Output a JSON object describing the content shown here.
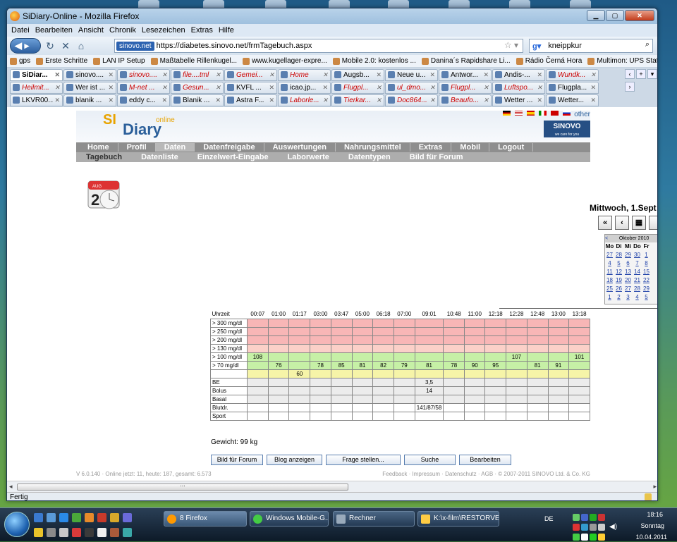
{
  "browser": {
    "window_title": "SiDiary-Online - Mozilla Firefox",
    "menu": [
      "Datei",
      "Bearbeiten",
      "Ansicht",
      "Chronik",
      "Lesezeichen",
      "Extras",
      "Hilfe"
    ],
    "identity_badge": "sinovo.net",
    "url": "https://diabetes.sinovo.net/frmTagebuch.aspx",
    "search_value": "kneippkur",
    "bookmarks": [
      "gps",
      "Erste Schritte",
      "LAN IP Setup",
      "Maßtabelle Rillenkugel...",
      "www.kugellager-expre...",
      "Mobile 2.0: kostenlos ...",
      "Danina´s Rapidshare Li...",
      "Rádio Černá Hora",
      "Multimon: UPS Status ..."
    ],
    "tab_rows": [
      [
        {
          "label": "SiDiar...",
          "active": true
        },
        {
          "label": "sinovo...."
        },
        {
          "label": "sinovo....",
          "red": true
        },
        {
          "label": "file....tml",
          "red": true
        },
        {
          "label": "Gemei...",
          "red": true
        },
        {
          "label": "Home",
          "red": true
        },
        {
          "label": "Augsb..."
        },
        {
          "label": "Neue u..."
        },
        {
          "label": "Antwor..."
        },
        {
          "label": "Andis-..."
        },
        {
          "label": "Wundk...",
          "red": true
        }
      ],
      [
        {
          "label": "Heilmit...",
          "red": true
        },
        {
          "label": "Wer ist ..."
        },
        {
          "label": "M-net ...",
          "red": true
        },
        {
          "label": "Gesun...",
          "red": true
        },
        {
          "label": "KVFL ..."
        },
        {
          "label": "icao.jp..."
        },
        {
          "label": "Flugpl...",
          "red": true
        },
        {
          "label": "ul_dmo...",
          "red": true
        },
        {
          "label": "Flugpl...",
          "red": true
        },
        {
          "label": "Luftspo...",
          "red": true
        },
        {
          "label": "Flugpla..."
        }
      ],
      [
        {
          "label": "LKVR00..."
        },
        {
          "label": "blanik ..."
        },
        {
          "label": "eddy c..."
        },
        {
          "label": "Blanik ..."
        },
        {
          "label": "Astra F..."
        },
        {
          "label": "Laborle...",
          "red": true
        },
        {
          "label": "Tierkar...",
          "red": true
        },
        {
          "label": "Doc864...",
          "red": true
        },
        {
          "label": "Beaufo...",
          "red": true
        },
        {
          "label": "Wetter ..."
        },
        {
          "label": "Wetter..."
        }
      ]
    ],
    "status": "Fertig"
  },
  "site": {
    "logo_si": "SI",
    "logo_diary": "Diary",
    "logo_online": "online",
    "lang_other": "other",
    "sinovo": "SINOVO",
    "sinovo_tag": "we care for you",
    "main_nav": [
      "Home",
      "Profil",
      "Daten",
      "Datenfreigabe",
      "Auswertungen",
      "Nahrungsmittel",
      "Extras",
      "Mobil",
      "Logout"
    ],
    "main_nav_selected": 2,
    "sub_nav": [
      "Tagebuch",
      "Datenliste",
      "Einzelwert-Eingabe",
      "Laborwerte",
      "Datentypen",
      "Bild für Forum"
    ],
    "cal_icon_month": "AUG",
    "cal_icon_day": "2",
    "date_heading": "Mittwoch, 1.Sept",
    "cal_nav": [
      "«",
      "‹",
      "▦",
      ""
    ],
    "mini_cal": {
      "month": "Oktober 2010",
      "prev": "<",
      "dow": [
        "Mo",
        "Di",
        "Mi",
        "Do",
        "Fr"
      ],
      "weeks": [
        [
          "27",
          "28",
          "29",
          "30",
          "1"
        ],
        [
          "4",
          "5",
          "6",
          "7",
          "8"
        ],
        [
          "11",
          "12",
          "13",
          "14",
          "15"
        ],
        [
          "18",
          "19",
          "20",
          "21",
          "22"
        ],
        [
          "25",
          "26",
          "27",
          "28",
          "29"
        ],
        [
          "1",
          "2",
          "3",
          "4",
          "5"
        ]
      ]
    },
    "diary_table": {
      "header_label": "Uhrzeit",
      "times": [
        "00:07",
        "01:00",
        "01:17",
        "03:00",
        "03:47",
        "05:00",
        "06:18",
        "07:00",
        "09:01",
        "10:48",
        "11:00",
        "12:18",
        "12:28",
        "12:48",
        "13:00",
        "13:18"
      ],
      "rows": [
        {
          "label": "> 300 mg/dl",
          "cls": "red",
          "cells": [
            "",
            "",
            "",
            "",
            "",
            "",
            "",
            "",
            "",
            "",
            "",
            "",
            "",
            "",
            "",
            ""
          ]
        },
        {
          "label": "> 250 mg/dl",
          "cls": "red",
          "cells": [
            "",
            "",
            "",
            "",
            "",
            "",
            "",
            "",
            "",
            "",
            "",
            "",
            "",
            "",
            "",
            ""
          ]
        },
        {
          "label": "> 200 mg/dl",
          "cls": "red",
          "cells": [
            "",
            "",
            "",
            "",
            "",
            "",
            "",
            "",
            "",
            "",
            "",
            "",
            "",
            "",
            "",
            ""
          ]
        },
        {
          "label": "> 130 mg/dl",
          "cls": "lred",
          "cells": [
            "",
            "",
            "",
            "",
            "",
            "",
            "",
            "",
            "",
            "",
            "",
            "",
            "",
            "",
            "",
            ""
          ]
        },
        {
          "label": "> 100 mg/dl",
          "cls": "gr",
          "cells": [
            "108",
            "",
            "",
            "",
            "",
            "",
            "",
            "",
            "",
            "",
            "",
            "",
            "107",
            "",
            "",
            "101"
          ]
        },
        {
          "label": ">  70 mg/dl",
          "cls": "gr",
          "cells": [
            "",
            "76",
            "",
            "78",
            "85",
            "81",
            "82",
            "79",
            "81",
            "78",
            "90",
            "95",
            "",
            "81",
            "91",
            ""
          ]
        },
        {
          "label": "",
          "cls": "yl",
          "cells": [
            "",
            "",
            "60",
            "",
            "",
            "",
            "",
            "",
            "",
            "",
            "",
            "",
            "",
            "",
            "",
            ""
          ]
        },
        {
          "label": "BE",
          "cls": "gy",
          "cells": [
            "",
            "",
            "",
            "",
            "",
            "",
            "",
            "",
            "3,5",
            "",
            "",
            "",
            "",
            "",
            "",
            ""
          ]
        },
        {
          "label": "Bolus",
          "cls": "gy",
          "cells": [
            "",
            "",
            "",
            "",
            "",
            "",
            "",
            "",
            "14",
            "",
            "",
            "",
            "",
            "",
            "",
            ""
          ]
        },
        {
          "label": "Basal",
          "cls": "gy",
          "cells": [
            "",
            "",
            "",
            "",
            "",
            "",
            "",
            "",
            "",
            "",
            "",
            "",
            "",
            "",
            "",
            ""
          ]
        },
        {
          "label": "Blutdr.",
          "cls": "wh",
          "cells": [
            "",
            "",
            "",
            "",
            "",
            "",
            "",
            "",
            "141/87/58",
            "",
            "",
            "",
            "",
            "",
            "",
            ""
          ]
        },
        {
          "label": "Sport",
          "cls": "wh",
          "cells": [
            "",
            "",
            "",
            "",
            "",
            "",
            "",
            "",
            "",
            "",
            "",
            "",
            "",
            "",
            "",
            ""
          ]
        }
      ]
    },
    "weight": "Gewicht: 99 kg",
    "buttons": [
      "Bild für Forum",
      "Blog anzeigen",
      "Frage stellen...",
      "Suche",
      "Bearbeiten"
    ],
    "footer_left": "V 6.0.140 · Online jetzt: 11, heute: 187, gesamt: 6.573",
    "footer_right": "Feedback · Impressum · Datenschutz · AGB · © 2007-2011 SINOVO Ltd. & Co. KG"
  },
  "taskbar": {
    "tasks": [
      "8 Firefox",
      "Windows Mobile-G...",
      "Rechner",
      "K:\\x-film\\RESTORVE..."
    ],
    "lang": "DE",
    "time": "18:16",
    "day": "Sonntag",
    "date": "10.04.2011"
  }
}
